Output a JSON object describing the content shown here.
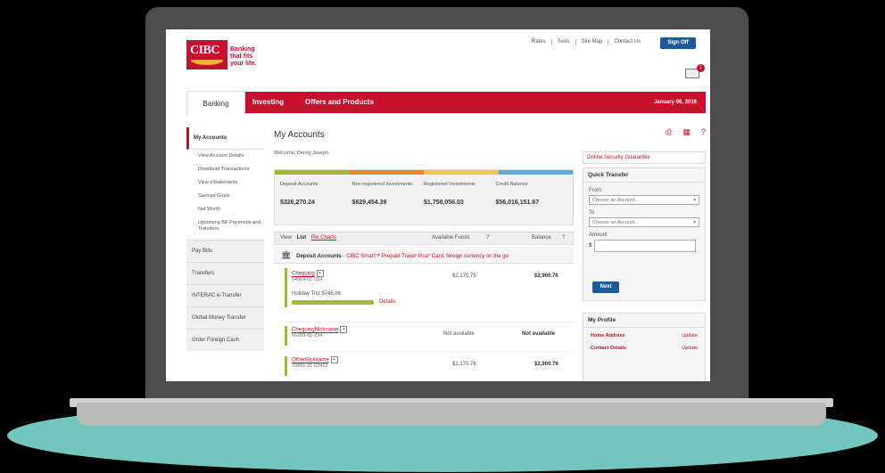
{
  "header": {
    "logo_text": "CIBC",
    "tagline": "Banking that fits your life.",
    "links": [
      "Rates",
      "Tools",
      "Site Map",
      "Contact Us"
    ],
    "signoff_label": "Sign Off",
    "mail_count": "1"
  },
  "nav": {
    "tabs": [
      "Banking",
      "Investing",
      "Offers and Products"
    ],
    "date": "January 06, 2016"
  },
  "sidebar": {
    "active": "My Accounts",
    "sub_items": [
      "View Account Details",
      "Download Transactions",
      "View eStatements",
      "Savings Goals",
      "Net Worth",
      "Upcoming Bill Payments and Transfers"
    ],
    "main_items": [
      "Pay Bills",
      "Transfers",
      "INTERAC e-Transfer",
      "Global Money Transfer",
      "Order Foreign Cash"
    ]
  },
  "main": {
    "title": "My Accounts",
    "welcome": "Welcome, Denny Joseph.",
    "summary": [
      {
        "label": "Deposit Accounts",
        "value": "$326,270.24",
        "color": "#a5b82e"
      },
      {
        "label": "Non-registered Investments",
        "value": "$629,454.39",
        "color": "#e8892a"
      },
      {
        "label": "Registered Investments",
        "value": "$1,758,056.03",
        "color": "#f2c94c"
      },
      {
        "label": "Credit Balance",
        "value": "$56,016,151.67",
        "color": "#5aa9df"
      }
    ],
    "view": {
      "label": "View",
      "list": "List",
      "pie": "Pie Charts",
      "col_funds": "Available Funds",
      "col_balance": "Balance"
    },
    "deposit_header": {
      "title": "Deposit Accounts",
      "promo": "- CIBC Smart™ Prepaid Travel Visa* Card, foreign currency on the go"
    },
    "accounts": [
      {
        "name": "Chequing",
        "number": "54569-01-234",
        "available": "$2,170.76",
        "balance": "$2,900.76",
        "goal": "Holiday Trip $746.96",
        "details": "Details"
      },
      {
        "name": "ChequingNickname",
        "number": "56789-01-234",
        "available": "Not available",
        "balance": "Not available"
      },
      {
        "name": "OtherNickname",
        "number": "79901-31-03412",
        "available": "$2,170.76",
        "balance": "$2,900.76"
      }
    ]
  },
  "right": {
    "security": "Online Security Guarantee",
    "quick_transfer": {
      "title": "Quick Transfer",
      "from_label": "From",
      "from_placeholder": "Choose an Account...",
      "to_label": "To",
      "to_placeholder": "Choose an Account...",
      "amount_label": "Amount",
      "currency": "$",
      "next_label": "Next"
    },
    "profile": {
      "title": "My Profile",
      "rows": [
        {
          "label": "Home Address",
          "action": "Update"
        },
        {
          "label": "Contact Details",
          "action": "Update"
        }
      ]
    }
  }
}
